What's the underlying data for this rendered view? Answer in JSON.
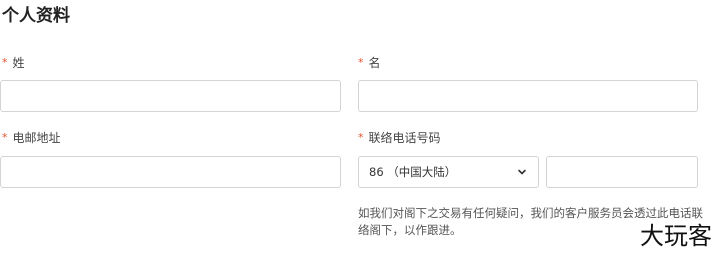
{
  "section": {
    "title": "个人资料"
  },
  "fields": {
    "last_name": {
      "required_mark": "*",
      "label": "姓",
      "value": ""
    },
    "first_name": {
      "required_mark": "*",
      "label": "名",
      "value": ""
    },
    "email": {
      "required_mark": "*",
      "label": "电邮地址",
      "value": ""
    },
    "phone": {
      "required_mark": "*",
      "label": "联络电话号码",
      "country_code_selected": "86 （中国大陆）",
      "number_value": ""
    }
  },
  "hint_text": "如我们对阁下之交易有任何疑问，我们的客户服务员会透过此电话联络阁下，以作跟进。",
  "watermark": "大玩客",
  "colors": {
    "required": "#e0522e",
    "border": "#d4d4d4"
  }
}
